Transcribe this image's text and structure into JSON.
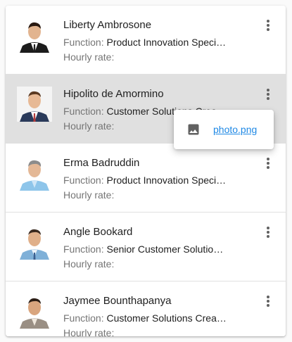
{
  "labels": {
    "function": "Function:",
    "hourly_rate": "Hourly rate:"
  },
  "employees": [
    {
      "name": "Liberty Ambrosone",
      "function": "Product Innovation Speci…",
      "hourly_rate": ""
    },
    {
      "name": "Hipolito de Amormino",
      "function": "Customer Solutions Crea…",
      "hourly_rate": ""
    },
    {
      "name": "Erma Badruddin",
      "function": "Product Innovation Speci…",
      "hourly_rate": ""
    },
    {
      "name": "Angle Bookard",
      "function": "Senior Customer Solutio…",
      "hourly_rate": ""
    },
    {
      "name": "Jaymee Bounthapanya",
      "function": "Customer Solutions Crea…",
      "hourly_rate": ""
    }
  ],
  "attachment_popup": {
    "file_name": "photo.png",
    "icon": "image-icon"
  },
  "colors": {
    "selected_row": "#e0e0e0",
    "link": "#1e88e5"
  }
}
